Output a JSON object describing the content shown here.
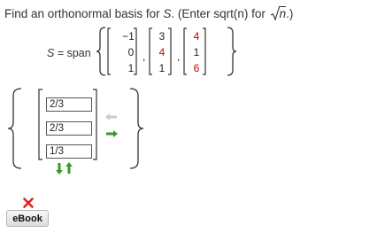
{
  "question": {
    "prefix": "Find an orthonormal basis for ",
    "set_var": "S",
    "middle": ". (Enter sqrt(n) for ",
    "radicand": "n",
    "suffix": ".)"
  },
  "span_label": {
    "var": "S",
    "text": " = span"
  },
  "vectors": [
    {
      "values": [
        "−1",
        "0",
        "1"
      ],
      "colors": [
        "#222222",
        "#222222",
        "#222222"
      ]
    },
    {
      "values": [
        "3",
        "4",
        "1"
      ],
      "colors": [
        "#222222",
        "#cc0000",
        "#222222"
      ]
    },
    {
      "values": [
        "4",
        "1",
        "6"
      ],
      "colors": [
        "#cc0000",
        "#222222",
        "#cc0000"
      ]
    }
  ],
  "commas": [
    ",",
    ","
  ],
  "answer_inputs": [
    {
      "value": "2/3"
    },
    {
      "value": "2/3"
    },
    {
      "value": "1/3"
    }
  ],
  "status_icon": "red-x-icon",
  "ebook_label": "eBook"
}
